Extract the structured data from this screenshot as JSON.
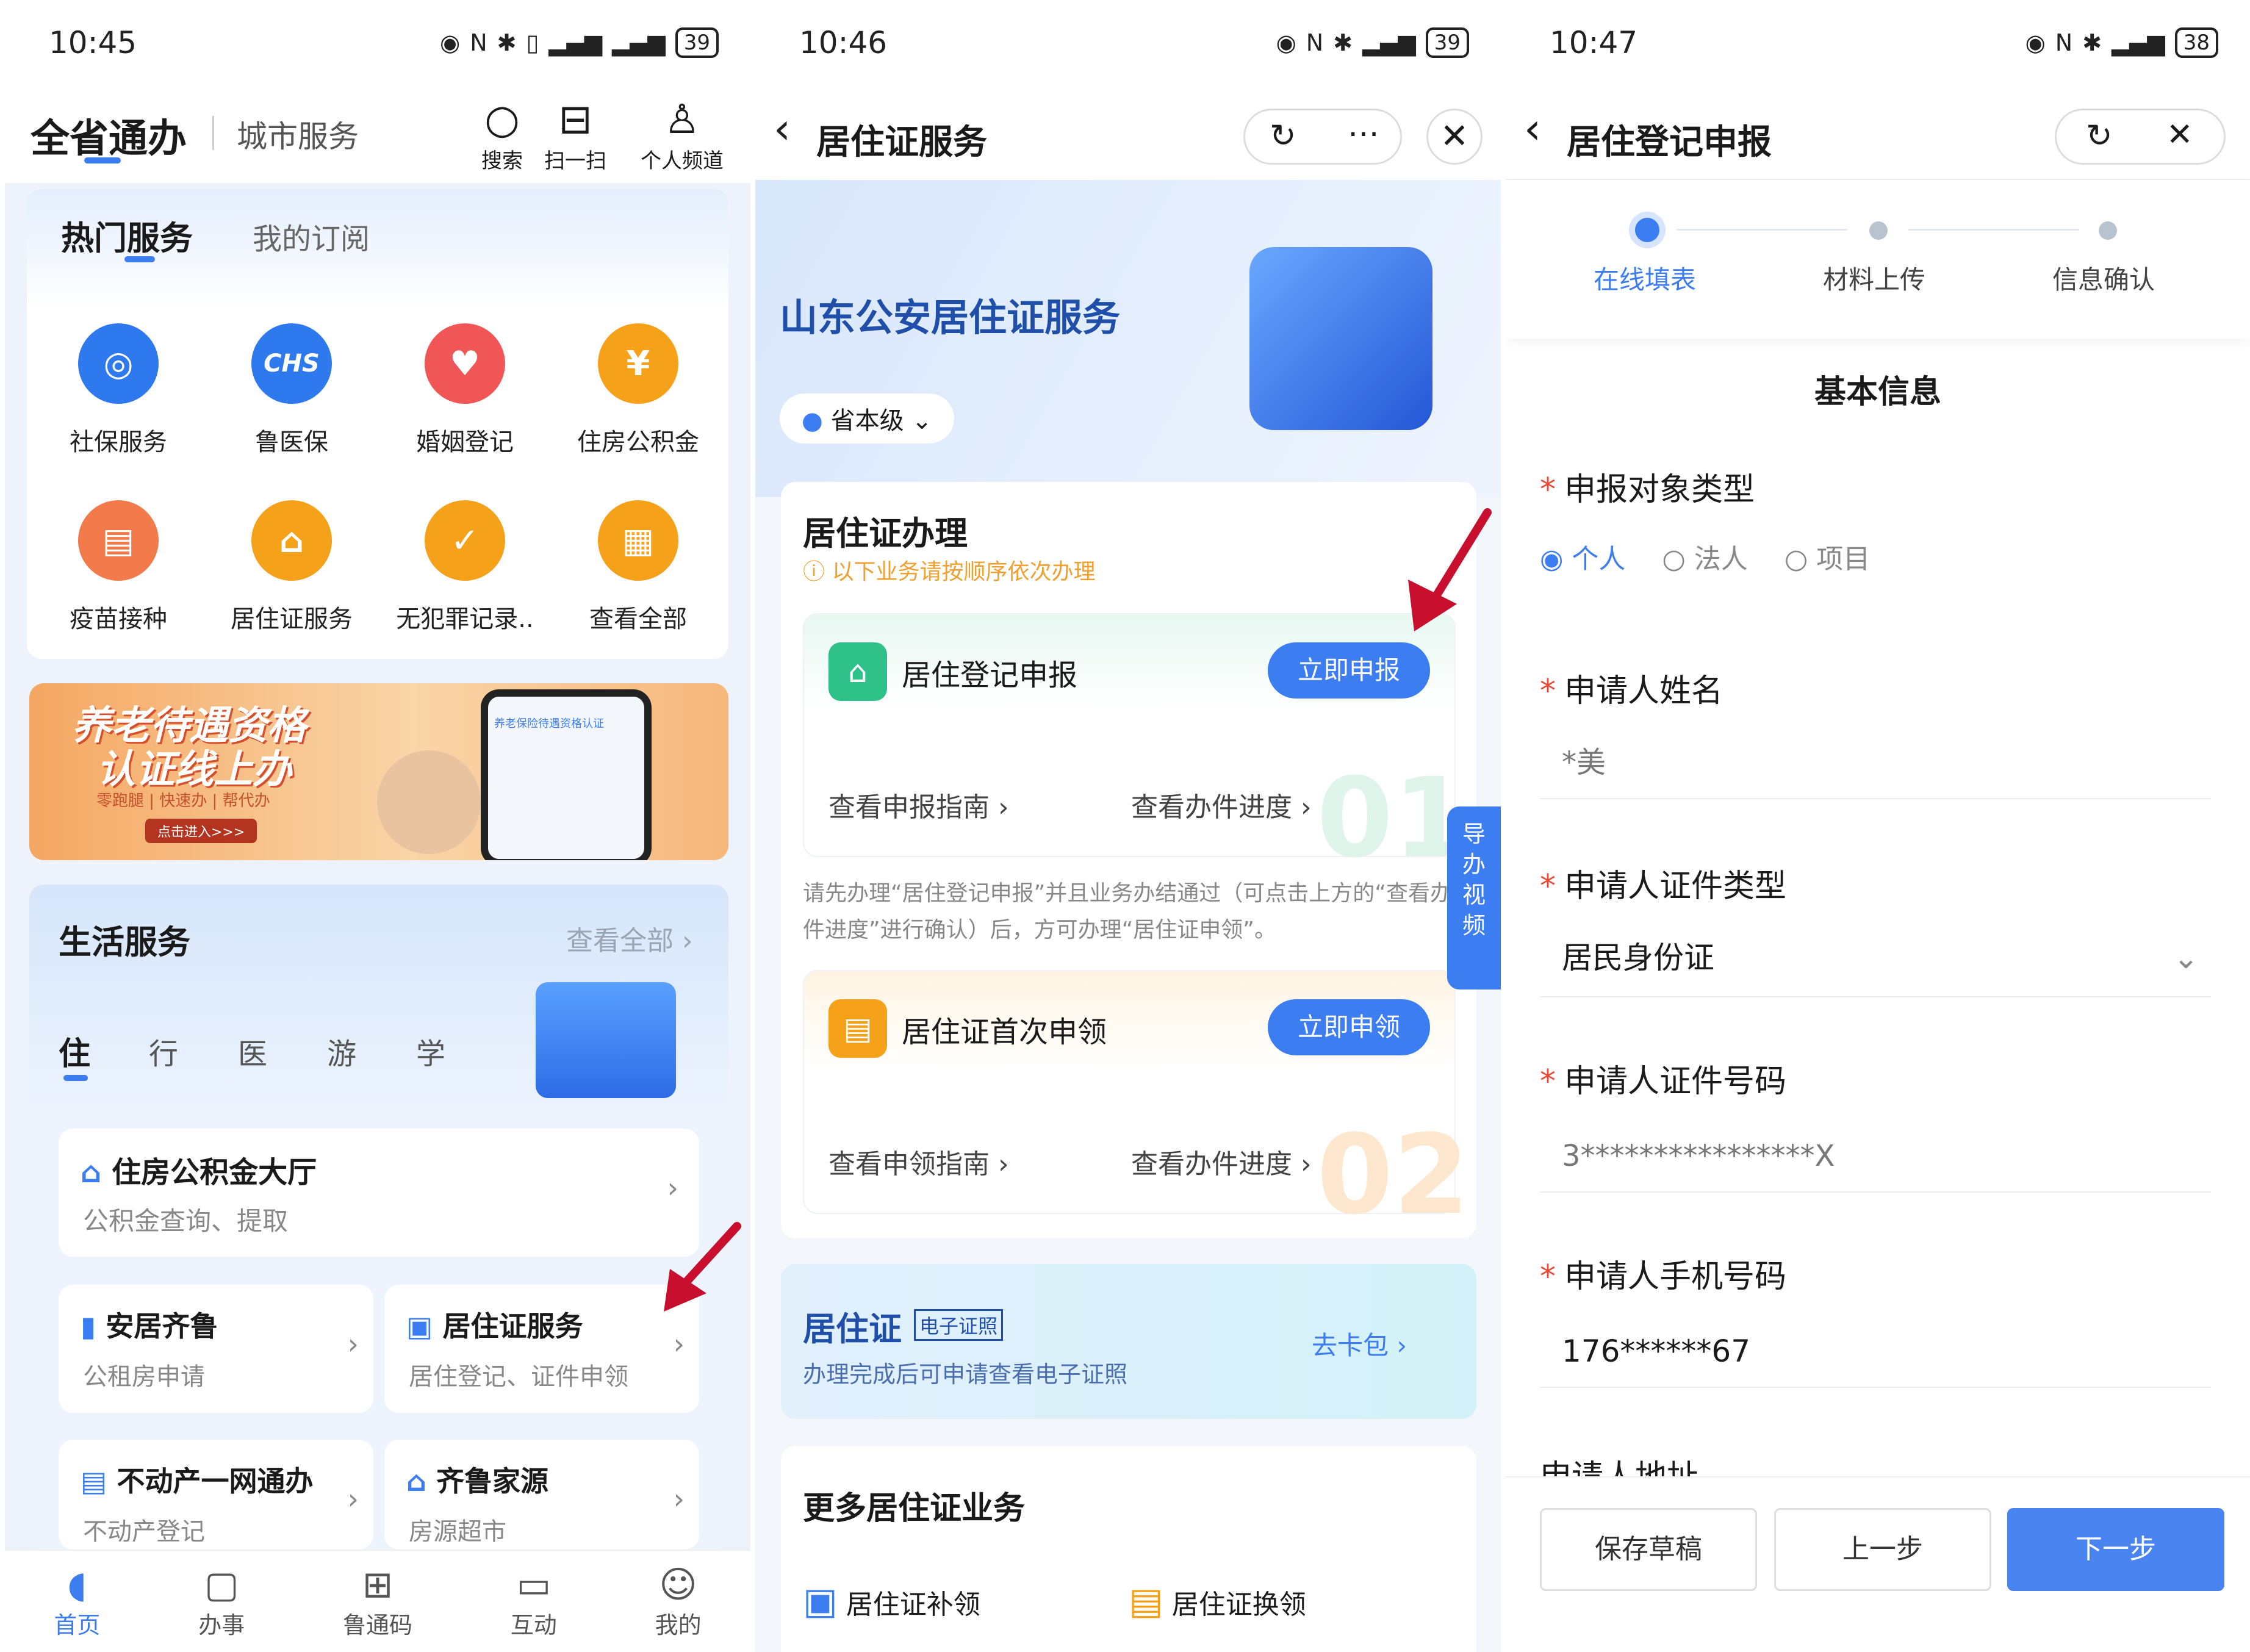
{
  "panel1": {
    "status": {
      "time": "10:45",
      "battery": "39"
    },
    "header": {
      "title": "全省通办",
      "subtitle": "城市服务",
      "search": "搜索",
      "scan": "扫一扫",
      "personal": "个人频道"
    },
    "hot": {
      "tab_active": "热门服务",
      "tab_other": "我的订阅",
      "items": [
        {
          "label": "社保服务",
          "icon": "shield-icon",
          "color": "#2f79ef"
        },
        {
          "label": "鲁医保",
          "icon": "chs-icon",
          "color": "#2f79ef",
          "mark": "CHS"
        },
        {
          "label": "婚姻登记",
          "icon": "couple-icon",
          "color": "#f05656"
        },
        {
          "label": "住房公积金",
          "icon": "yuan-house-icon",
          "color": "#f6a11a",
          "mark": "¥"
        },
        {
          "label": "疫苗接种",
          "icon": "vaccine-icon",
          "color": "#f27a4b"
        },
        {
          "label": "居住证服务",
          "icon": "residence-card-icon",
          "color": "#f6a11a"
        },
        {
          "label": "无犯罪记录..",
          "icon": "record-icon",
          "color": "#f6a11a"
        },
        {
          "label": "查看全部",
          "icon": "grid-icon",
          "color": "#f6a11a"
        }
      ]
    },
    "banner": {
      "line1": "养老待遇资格",
      "line2": "认证线上办",
      "tags": "零跑腿 | 快速办 | 帮代办",
      "cta": "点击进入>>>",
      "phone_caption": "养老保险待遇资格认证"
    },
    "life": {
      "title": "生活服务",
      "view_all": "查看全部",
      "tabs": [
        "住",
        "行",
        "医",
        "游",
        "学"
      ],
      "fund": {
        "title": "住房公积金大厅",
        "desc": "公积金查询、提取"
      },
      "cards": [
        {
          "title": "安居齐鲁",
          "desc": "公租房申请"
        },
        {
          "title": "居住证服务",
          "desc": "居住登记、证件申领"
        },
        {
          "title": "不动产一网通办",
          "desc": "不动产登记"
        },
        {
          "title": "齐鲁家源",
          "desc": "房源超市"
        }
      ]
    },
    "nav": [
      {
        "label": "首页",
        "icon": "home-icon"
      },
      {
        "label": "办事",
        "icon": "doc-icon"
      },
      {
        "label": "鲁通码",
        "icon": "qr-icon"
      },
      {
        "label": "互动",
        "icon": "chat-icon"
      },
      {
        "label": "我的",
        "icon": "smile-icon"
      }
    ],
    "colors": {
      "accent": "#3c7ef2",
      "arrow": "#c8102e"
    }
  },
  "panel2": {
    "status": {
      "time": "10:46",
      "battery": "39"
    },
    "header": {
      "title": "居住证服务"
    },
    "hero": {
      "title": "山东公安居住证服务",
      "level": "省本级"
    },
    "section": {
      "title": "居住证办理",
      "hint": "以下业务请按顺序依次办理"
    },
    "items": [
      {
        "title": "居住登记申报",
        "button": "立即申报",
        "guide": "查看申报指南",
        "progress": "查看办件进度",
        "num": "01"
      },
      {
        "title": "居住证首次申领",
        "button": "立即申领",
        "guide": "查看申领指南",
        "progress": "查看办件进度",
        "num": "02"
      }
    ],
    "note": "请先办理“居住登记申报”并且业务办结通过（可点击上方的“查看办件进度”进行确认）后，方可办理“居住证申领”。",
    "side_tab": [
      "导",
      "办",
      "视",
      "频"
    ],
    "ecard": {
      "title": "居住证",
      "tag": "电子证照",
      "desc": "办理完成后可申请查看电子证照",
      "link": "去卡包"
    },
    "more": {
      "title": "更多居住证业务",
      "items": [
        "居住证补领",
        "居住证换领"
      ]
    }
  },
  "panel3": {
    "status": {
      "time": "10:47",
      "battery": "38"
    },
    "header": {
      "title": "居住登记申报"
    },
    "steps": [
      "在线填表",
      "材料上传",
      "信息确认"
    ],
    "form_title": "基本信息",
    "fields": {
      "type_label": "申报对象类型",
      "type_options": [
        "个人",
        "法人",
        "项目"
      ],
      "name_label": "申请人姓名",
      "name_value": "*美",
      "idtype_label": "申请人证件类型",
      "idtype_value": "居民身份证",
      "idno_label": "申请人证件号码",
      "idno_value": "3****************X",
      "phone_label": "申请人手机号码",
      "phone_value": "176******67",
      "addr_label": "申请人地址"
    },
    "buttons": {
      "draft": "保存草稿",
      "prev": "上一步",
      "next": "下一步"
    }
  }
}
